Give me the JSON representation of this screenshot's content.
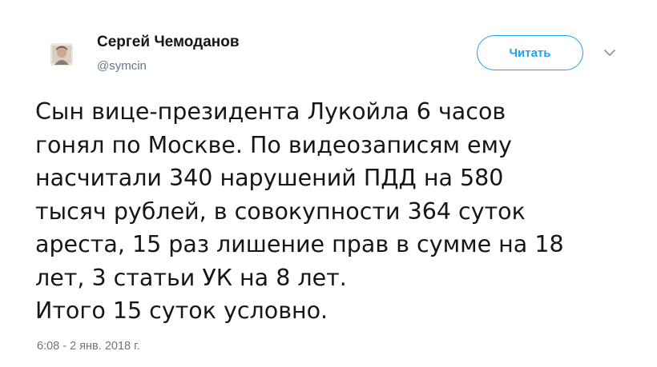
{
  "user": {
    "name": "Сергей Чемоданов",
    "handle": "@symcin"
  },
  "follow_button": {
    "label": "Читать"
  },
  "menu_icon": "chevron-down-icon",
  "tweet": {
    "lines": [
      "Сын вице-президента Лукойла 6 часов",
      "гонял по Москве. По видеозаписям ему",
      "насчитали 340 нарушений ПДД на 580",
      "тысяч рублей, в совокупности 364 суток",
      "ареста, 15 раз лишение прав в сумме на 18",
      "лет, 3 статьи УК на 8 лет.",
      "Итого 15 суток условно."
    ],
    "timestamp": "6:08 - 2 янв. 2018 г."
  },
  "colors": {
    "accent": "#1da1f2",
    "text": "#14171a",
    "muted": "#657786"
  }
}
